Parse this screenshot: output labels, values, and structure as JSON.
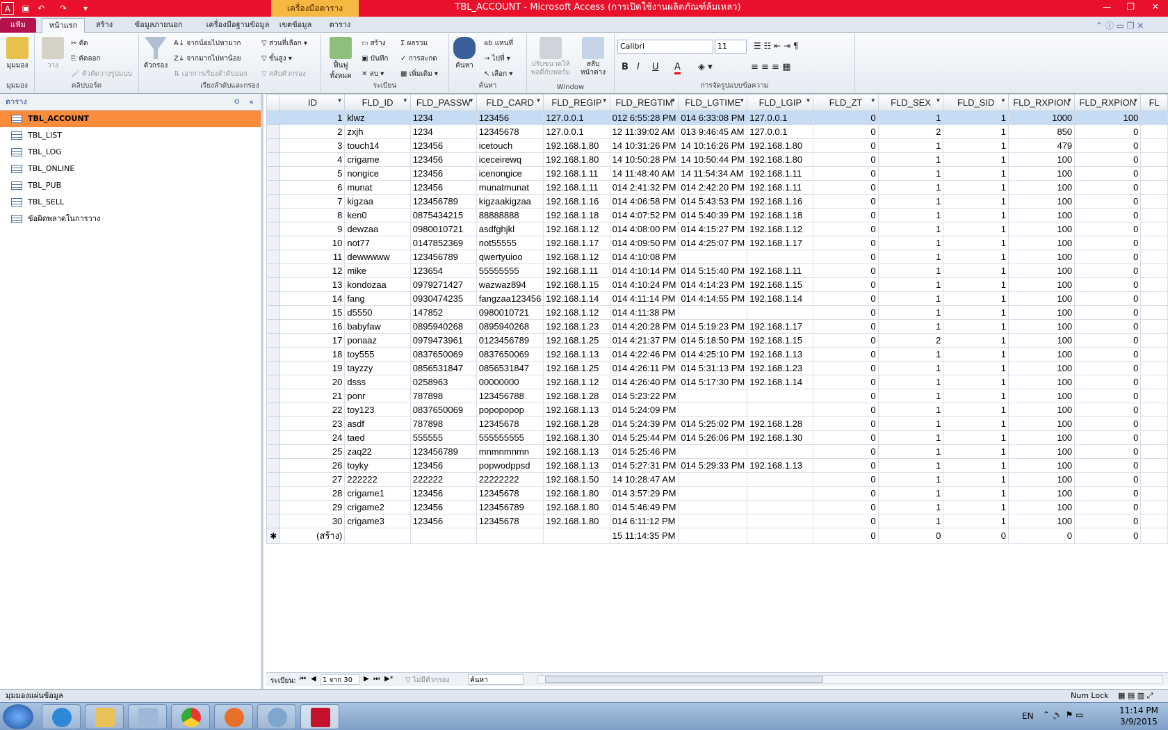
{
  "titlebar": {
    "context_tab": "เครื่องมือตาราง",
    "title": "TBL_ACCOUNT - Microsoft Access (การเปิดใช้งานผลิตภัณฑ์ล้มเหลว)"
  },
  "tabs": [
    "แฟ้ม",
    "หน้าแรก",
    "สร้าง",
    "ข้อมูลภายนอก",
    "เครื่องมือฐานข้อมูล",
    "เขตข้อมูล",
    "ตาราง"
  ],
  "ribbon": {
    "views": {
      "view": "มุมมอง",
      "label": "มุมมอง"
    },
    "clipboard": {
      "paste": "วาง",
      "cut": "ตัด",
      "copy": "คัดลอก",
      "format_painter": "ตัวคัดวางรูปแบบ",
      "label": "คลิปบอร์ด"
    },
    "sort": {
      "filter": "ตัวกรอง",
      "asc": "จากน้อยไปหามาก",
      "desc": "จากมากไปหาน้อย",
      "remove_sort": "เอาการเรียงลำดับออก",
      "selection": "ส่วนที่เลือก",
      "advanced": "ขั้นสูง",
      "toggle": "สลับตัวกรอง",
      "label": "เรียงลำดับและกรอง"
    },
    "records": {
      "refresh": "ฟื้นฟูทั้งหมด",
      "new": "สร้าง",
      "save": "บันทึก",
      "delete": "ลบ",
      "totals": "ผลรวม",
      "spelling": "การสะกด",
      "more": "เพิ่มเติม",
      "label": "ระเบียน"
    },
    "find": {
      "find": "ค้นหา",
      "replace": "แทนที่",
      "goto": "ไปที่",
      "select": "เลือก",
      "label": "ค้นหา"
    },
    "window": {
      "size": "ปรับขนาดให้พอดีกับฟอร์ม",
      "switch": "สลับหน้าต่าง",
      "label": "Window"
    },
    "text": {
      "font": "Calibri",
      "size": "11",
      "label": "การจัดรูปแบบข้อความ"
    }
  },
  "nav": {
    "header": "ตาราง",
    "items": [
      "TBL_ACCOUNT",
      "TBL_LIST",
      "TBL_LOG",
      "TBL_ONLINE",
      "TBL_PUB",
      "TBL_SELL",
      "ข้อผิดพลาดในการวาง"
    ]
  },
  "grid": {
    "columns": [
      "ID",
      "FLD_ID",
      "FLD_PASSW",
      "FLD_CARD",
      "FLD_REGIP",
      "FLD_REGTIM",
      "FLD_LGTIME",
      "FLD_LGIP",
      "FLD_ZT",
      "FLD_SEX",
      "FLD_SID",
      "FLD_RXPION",
      "FLD_RXPION",
      "FL"
    ],
    "rows": [
      [
        "1",
        "klwz",
        "1234",
        "123456",
        "127.0.0.1",
        "012 6:55:28 PM",
        "014 6:33:08 PM",
        "127.0.0.1",
        "0",
        "1",
        "1",
        "1000",
        "100"
      ],
      [
        "2",
        "zxjh",
        "1234",
        "12345678",
        "127.0.0.1",
        "12 11:39:02 AM",
        "013 9:46:45 AM",
        "127.0.0.1",
        "0",
        "2",
        "1",
        "850",
        "0"
      ],
      [
        "3",
        "touch14",
        "123456",
        "icetouch",
        "192.168.1.80",
        "14 10:31:26 PM",
        "14 10:16:26 PM",
        "192.168.1.80",
        "0",
        "1",
        "1",
        "479",
        "0"
      ],
      [
        "4",
        "crigame",
        "123456",
        "iceceirewq",
        "192.168.1.80",
        "14 10:50:28 PM",
        "14 10:50:44 PM",
        "192.168.1.80",
        "0",
        "1",
        "1",
        "100",
        "0"
      ],
      [
        "5",
        "nongice",
        "123456",
        "icenongice",
        "192.168.1.11",
        "14 11:48:40 AM",
        "14 11:54:34 AM",
        "192.168.1.11",
        "0",
        "1",
        "1",
        "100",
        "0"
      ],
      [
        "6",
        "munat",
        "123456",
        "munatmunat",
        "192.168.1.11",
        "014 2:41:32 PM",
        "014 2:42:20 PM",
        "192.168.1.11",
        "0",
        "1",
        "1",
        "100",
        "0"
      ],
      [
        "7",
        "kigzaa",
        "123456789",
        "kigzaakigzaa",
        "192.168.1.16",
        "014 4:06:58 PM",
        "014 5:43:53 PM",
        "192.168.1.16",
        "0",
        "1",
        "1",
        "100",
        "0"
      ],
      [
        "8",
        "ken0",
        "0875434215",
        "88888888",
        "192.168.1.18",
        "014 4:07:52 PM",
        "014 5:40:39 PM",
        "192.168.1.18",
        "0",
        "1",
        "1",
        "100",
        "0"
      ],
      [
        "9",
        "dewzaa",
        "0980010721",
        "asdfghjkl",
        "192.168.1.12",
        "014 4:08:00 PM",
        "014 4:15:27 PM",
        "192.168.1.12",
        "0",
        "1",
        "1",
        "100",
        "0"
      ],
      [
        "10",
        "not77",
        "0147852369",
        "not55555",
        "192.168.1.17",
        "014 4:09:50 PM",
        "014 4:25:07 PM",
        "192.168.1.17",
        "0",
        "1",
        "1",
        "100",
        "0"
      ],
      [
        "11",
        "dewwwww",
        "123456789",
        "qwertyuioo",
        "192.168.1.12",
        "014 4:10:08 PM",
        "",
        "",
        "0",
        "1",
        "1",
        "100",
        "0"
      ],
      [
        "12",
        "mike",
        "123654",
        "55555555",
        "192.168.1.11",
        "014 4:10:14 PM",
        "014 5:15:40 PM",
        "192.168.1.11",
        "0",
        "1",
        "1",
        "100",
        "0"
      ],
      [
        "13",
        "kondozaa",
        "0979271427",
        "wazwaz894",
        "192.168.1.15",
        "014 4:10:24 PM",
        "014 4:14:23 PM",
        "192.168.1.15",
        "0",
        "1",
        "1",
        "100",
        "0"
      ],
      [
        "14",
        "fang",
        "0930474235",
        "fangzaa123456",
        "192.168.1.14",
        "014 4:11:14 PM",
        "014 4:14:55 PM",
        "192.168.1.14",
        "0",
        "1",
        "1",
        "100",
        "0"
      ],
      [
        "15",
        "d5550",
        "147852",
        "0980010721",
        "192.168.1.12",
        "014 4:11:38 PM",
        "",
        "",
        "0",
        "1",
        "1",
        "100",
        "0"
      ],
      [
        "16",
        "babyfaw",
        "0895940268",
        "0895940268",
        "192.168.1.23",
        "014 4:20:28 PM",
        "014 5:19:23 PM",
        "192.168.1.17",
        "0",
        "1",
        "1",
        "100",
        "0"
      ],
      [
        "17",
        "ponaaz",
        "0979473961",
        "0123456789",
        "192.168.1.25",
        "014 4:21:37 PM",
        "014 5:18:50 PM",
        "192.168.1.15",
        "0",
        "2",
        "1",
        "100",
        "0"
      ],
      [
        "18",
        "toy555",
        "0837650069",
        "0837650069",
        "192.168.1.13",
        "014 4:22:46 PM",
        "014 4:25:10 PM",
        "192.168.1.13",
        "0",
        "1",
        "1",
        "100",
        "0"
      ],
      [
        "19",
        "tayzzy",
        "0856531847",
        "0856531847",
        "192.168.1.25",
        "014 4:26:11 PM",
        "014 5:31:13 PM",
        "192.168.1.23",
        "0",
        "1",
        "1",
        "100",
        "0"
      ],
      [
        "20",
        "dsss",
        "0258963",
        "00000000",
        "192.168.1.12",
        "014 4:26:40 PM",
        "014 5:17:30 PM",
        "192.168.1.14",
        "0",
        "1",
        "1",
        "100",
        "0"
      ],
      [
        "21",
        "ponr",
        "787898",
        "123456788",
        "192.168.1.28",
        "014 5:23:22 PM",
        "",
        "",
        "0",
        "1",
        "1",
        "100",
        "0"
      ],
      [
        "22",
        "toy123",
        "0837650069",
        "popopopop",
        "192.168.1.13",
        "014 5:24:09 PM",
        "",
        "",
        "0",
        "1",
        "1",
        "100",
        "0"
      ],
      [
        "23",
        "asdf",
        "787898",
        "12345678",
        "192.168.1.28",
        "014 5:24:39 PM",
        "014 5:25:02 PM",
        "192.168.1.28",
        "0",
        "1",
        "1",
        "100",
        "0"
      ],
      [
        "24",
        "taed",
        "555555",
        "555555555",
        "192.168.1.30",
        "014 5:25:44 PM",
        "014 5:26:06 PM",
        "192.168.1.30",
        "0",
        "1",
        "1",
        "100",
        "0"
      ],
      [
        "25",
        "zaq22",
        "123456789",
        "mnmnmnmn",
        "192.168.1.13",
        "014 5:25:46 PM",
        "",
        "",
        "0",
        "1",
        "1",
        "100",
        "0"
      ],
      [
        "26",
        "toyky",
        "123456",
        "popwodppsd",
        "192.168.1.13",
        "014 5:27:31 PM",
        "014 5:29:33 PM",
        "192.168.1.13",
        "0",
        "1",
        "1",
        "100",
        "0"
      ],
      [
        "27",
        "222222",
        "222222",
        "22222222",
        "192.168.1.50",
        "14 10:28:47 AM",
        "",
        "",
        "0",
        "1",
        "1",
        "100",
        "0"
      ],
      [
        "28",
        "crigame1",
        "123456",
        "12345678",
        "192.168.1.80",
        "014 3:57:29 PM",
        "",
        "",
        "0",
        "1",
        "1",
        "100",
        "0"
      ],
      [
        "29",
        "crigame2",
        "123456",
        "123456789",
        "192.168.1.80",
        "014 5:46:49 PM",
        "",
        "",
        "0",
        "1",
        "1",
        "100",
        "0"
      ],
      [
        "30",
        "crigame3",
        "123456",
        "12345678",
        "192.168.1.80",
        "014 6:11:12 PM",
        "",
        "",
        "0",
        "1",
        "1",
        "100",
        "0"
      ]
    ],
    "new_row": [
      "(สร้าง)",
      "",
      "",
      "",
      "",
      "15 11:14:35 PM",
      "",
      "",
      "0",
      "0",
      "0",
      "0",
      "0"
    ]
  },
  "recnav": {
    "label": "ระเบียน:",
    "position": "1 จาก 30",
    "no_filter": "ไม่มีตัวกรอง",
    "search": "ค้นหา"
  },
  "status": {
    "left": "มุมมองแผ่นข้อมูล",
    "numlock": "Num Lock"
  },
  "tray": {
    "lang": "EN",
    "time": "11:14 PM",
    "date": "3/9/2015"
  }
}
